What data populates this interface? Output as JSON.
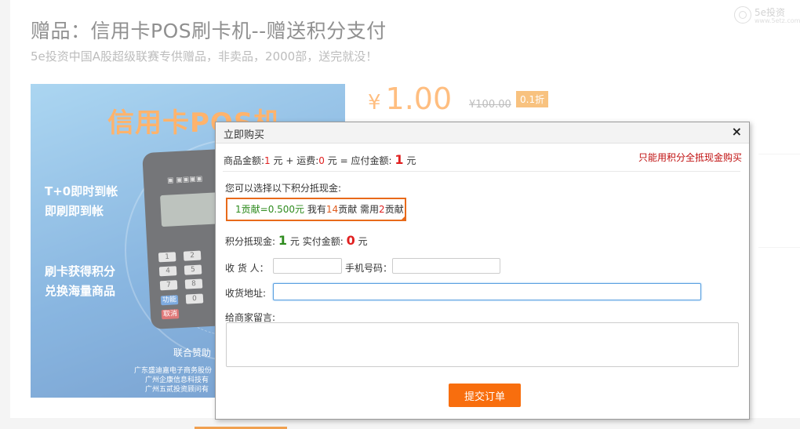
{
  "header": {
    "title": "赠品：信用卡POS刷卡机--赠送积分支付",
    "subtitle": "5e投资中国A股超级联赛专供赠品，非卖品，2000部，送完就没！",
    "logo_text": "5e投资",
    "logo_sub": "www.5etz.com"
  },
  "product_image": {
    "headline": "信用卡POS机",
    "line1": "T+0即时到帐",
    "line2": "即刷即到帐",
    "line3": "刷卡获得积分",
    "line4": "兑换海量商品",
    "sponsor_label": "联合赞助",
    "sponsor_1": "广东盛迪嘉电子商务股份",
    "sponsor_2": "广州企康信息科技有",
    "sponsor_3": "广州五贰投资顾问有",
    "device_keys": [
      "1",
      "2",
      "4",
      "5",
      "7",
      "8",
      "功能",
      "0",
      "取消"
    ]
  },
  "price": {
    "currency": "¥",
    "value": "1.00",
    "original": "¥100.00",
    "discount": "0.1折"
  },
  "modal": {
    "title": "立即购买",
    "close": "×",
    "amount_label": "商品金额:",
    "amount_value": "1",
    "unit_yuan": "元",
    "plus_shipping": "+ 运费:",
    "shipping_value": "0",
    "equals_payable": "= 应付金额:",
    "payable_value": "1",
    "notice": "只能用积分全抵现金购买",
    "choose_label": "您可以选择以下积分抵现金:",
    "points": {
      "one": "1贡献",
      "rate": "=0.500元",
      "have_label": "我有",
      "have": "14",
      "gongxian": "贡献",
      "need_label": "需用",
      "need": "2"
    },
    "offset_label": "积分抵现金:",
    "offset_value": "1",
    "actual_label": "实付金额:",
    "actual_value": "0",
    "receiver_label": "收 货 人：",
    "receiver_value": "",
    "phone_label": "手机号码：",
    "phone_value": "",
    "address_label": "收货地址:",
    "address_value": "",
    "message_label": "给商家留言:",
    "message_value": "",
    "submit_label": "提交订单"
  },
  "colors": {
    "accent": "#f86e0e",
    "price": "#ff9b3d",
    "highlight_border": "#e86a1a",
    "red": "#e02020",
    "green": "#2e8b1e"
  }
}
